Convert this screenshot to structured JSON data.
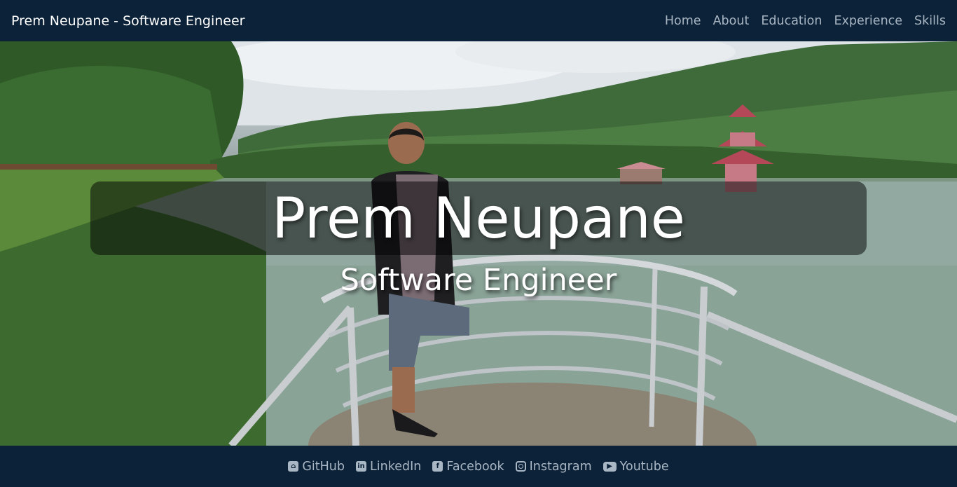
{
  "header": {
    "brand": "Prem Neupane - Software Engineer",
    "nav": [
      "Home",
      "About",
      "Education",
      "Experience",
      "Skills"
    ]
  },
  "hero": {
    "name": "Prem Neupane",
    "role": "Software Engineer"
  },
  "footer": {
    "links": [
      {
        "label": "GitHub",
        "icon": "github-icon"
      },
      {
        "label": "LinkedIn",
        "icon": "linkedin-icon"
      },
      {
        "label": "Facebook",
        "icon": "facebook-icon"
      },
      {
        "label": "Instagram",
        "icon": "instagram-icon"
      },
      {
        "label": "Youtube",
        "icon": "youtube-icon"
      }
    ]
  },
  "colors": {
    "navbar_bg": "#0c2239",
    "nav_link": "#a9b6c3",
    "brand_text": "#ffffff"
  }
}
